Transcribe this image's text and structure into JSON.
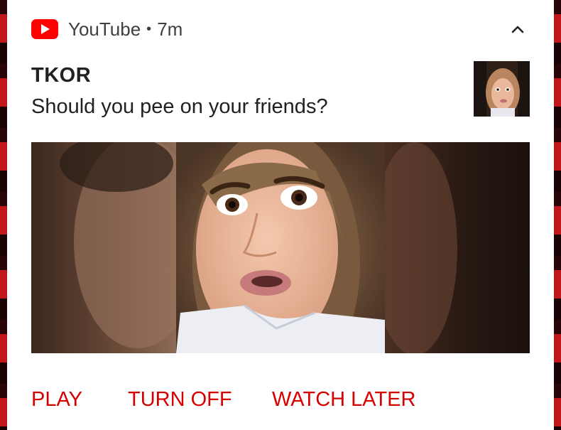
{
  "notification": {
    "app_name": "YouTube",
    "separator": "•",
    "time": "7m",
    "title": "TKOR",
    "text": "Should you pee on your friends?",
    "icons": {
      "app": "youtube-logo-icon",
      "collapse": "chevron-up-icon"
    },
    "actions": [
      {
        "label": "PLAY"
      },
      {
        "label": "TURN OFF"
      },
      {
        "label": "WATCH LATER"
      }
    ],
    "colors": {
      "accent": "#d50000",
      "logo": "#ff0000"
    }
  }
}
